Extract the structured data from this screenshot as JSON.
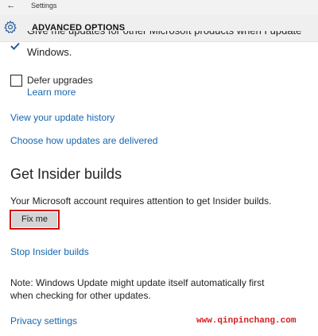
{
  "titlebar": {
    "back_icon": "←",
    "app_name": "Settings"
  },
  "header": {
    "icon": "gear-icon",
    "title": "ADVANCED OPTIONS"
  },
  "options": {
    "partial_line": "Give me updates for other Microsoft products when I update",
    "partial_line_end": "Windows.",
    "defer_label": "Defer upgrades",
    "learn_more": "Learn more"
  },
  "links": {
    "history": "View your update history",
    "delivery": "Choose how updates are delivered"
  },
  "insider": {
    "heading": "Get Insider builds",
    "message": "Your Microsoft account requires attention to get Insider builds.",
    "fix_button": "Fix me",
    "stop_link": "Stop Insider builds"
  },
  "note": "Note: Windows Update might update itself automatically first when checking for other updates.",
  "privacy_link": "Privacy settings",
  "watermark": "www.qinpinchang.com",
  "colors": {
    "link": "#1666b0",
    "highlight": "#cc1010",
    "watermark": "#d61c1c"
  }
}
